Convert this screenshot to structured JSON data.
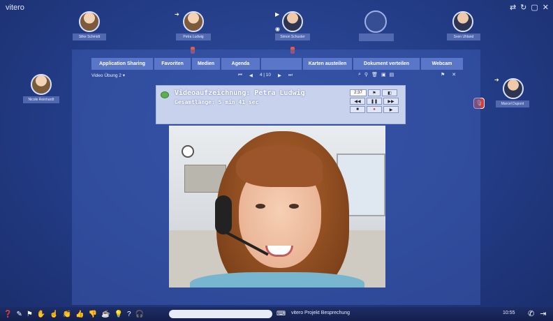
{
  "app": {
    "logo": "vitero",
    "window_controls": [
      "⇄",
      "↻",
      "▢",
      "✕"
    ]
  },
  "participants": [
    {
      "name": "Silke Schmidt"
    },
    {
      "name": "Petra Ludwig"
    },
    {
      "name": "Simon Schuster"
    },
    {
      "name": ""
    },
    {
      "name": "Sven Uhland"
    },
    {
      "name": "Nicole Reinhardt"
    },
    {
      "name": "Marcel Dupont"
    }
  ],
  "tabs": [
    {
      "label": "Application Sharing"
    },
    {
      "label": "Favoriten"
    },
    {
      "label": "Medien"
    },
    {
      "label": "Agenda"
    },
    {
      "label": ""
    },
    {
      "label": "Karten austeilen"
    },
    {
      "label": "Dokument verteilen"
    },
    {
      "label": "Webcam"
    }
  ],
  "toolbar": {
    "selection": "Video Übung 2",
    "page": "4 | 10"
  },
  "video_panel": {
    "title": "Videoaufzeichnung: Petra Ludwig",
    "duration": "Gesamtlänge: 5 min 41 sec",
    "time": "2:37"
  },
  "taskbar": {
    "title": "vitero Projekt Besprechung",
    "time": "10:55"
  }
}
